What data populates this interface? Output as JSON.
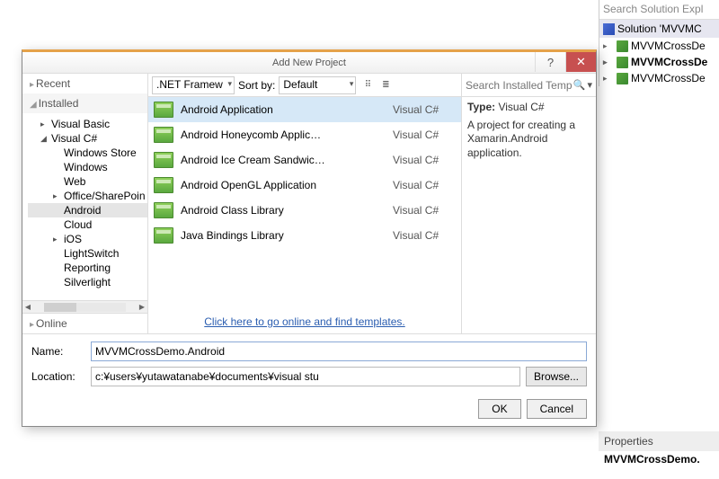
{
  "solution_explorer": {
    "search_placeholder": "Search Solution Expl",
    "solution_label": "Solution 'MVVMC",
    "items": [
      {
        "label": "MVVMCrossDe",
        "bold": false
      },
      {
        "label": "MVVMCrossDe",
        "bold": true
      },
      {
        "label": "MVVMCrossDe",
        "bold": false
      }
    ]
  },
  "properties": {
    "header": "Properties",
    "item": "MVVMCrossDemo."
  },
  "dialog": {
    "title": "Add New Project",
    "left": {
      "recent": "Recent",
      "installed": "Installed",
      "online": "Online",
      "tree": [
        {
          "label": "Visual Basic",
          "indent": 1,
          "caret": "▸"
        },
        {
          "label": "Visual C#",
          "indent": 1,
          "caret": "◢"
        },
        {
          "label": "Windows Store",
          "indent": 2,
          "caret": ""
        },
        {
          "label": "Windows",
          "indent": 2,
          "caret": ""
        },
        {
          "label": "Web",
          "indent": 2,
          "caret": ""
        },
        {
          "label": "Office/SharePoin",
          "indent": 2,
          "caret": "▸"
        },
        {
          "label": "Android",
          "indent": 2,
          "caret": "",
          "selected": true
        },
        {
          "label": "Cloud",
          "indent": 2,
          "caret": ""
        },
        {
          "label": "iOS",
          "indent": 2,
          "caret": "▸"
        },
        {
          "label": "LightSwitch",
          "indent": 2,
          "caret": ""
        },
        {
          "label": "Reporting",
          "indent": 2,
          "caret": ""
        },
        {
          "label": "Silverlight",
          "indent": 2,
          "caret": ""
        }
      ]
    },
    "toolbar": {
      "framework": ".NET Framew",
      "sortby_label": "Sort by:",
      "sortby_value": "Default"
    },
    "templates": [
      {
        "name": "Android Application",
        "lang": "Visual C#",
        "selected": true
      },
      {
        "name": "Android Honeycomb Applic…",
        "lang": "Visual C#"
      },
      {
        "name": "Android Ice Cream Sandwic…",
        "lang": "Visual C#"
      },
      {
        "name": "Android OpenGL Application",
        "lang": "Visual C#"
      },
      {
        "name": "Android Class Library",
        "lang": "Visual C#"
      },
      {
        "name": "Java Bindings Library",
        "lang": "Visual C#"
      }
    ],
    "online_link": "Click here to go online and find templates.",
    "right": {
      "search_placeholder": "Search Installed Temp",
      "type_label": "Type:",
      "type_value": "Visual C#",
      "description": "A project for creating a Xamarin.Android application."
    },
    "fields": {
      "name_label": "Name:",
      "name_value": "MVVMCrossDemo.Android",
      "location_label": "Location:",
      "location_value": "c:¥users¥yutawatanabe¥documents¥visual stu",
      "browse": "Browse..."
    },
    "buttons": {
      "ok": "OK",
      "cancel": "Cancel"
    }
  }
}
